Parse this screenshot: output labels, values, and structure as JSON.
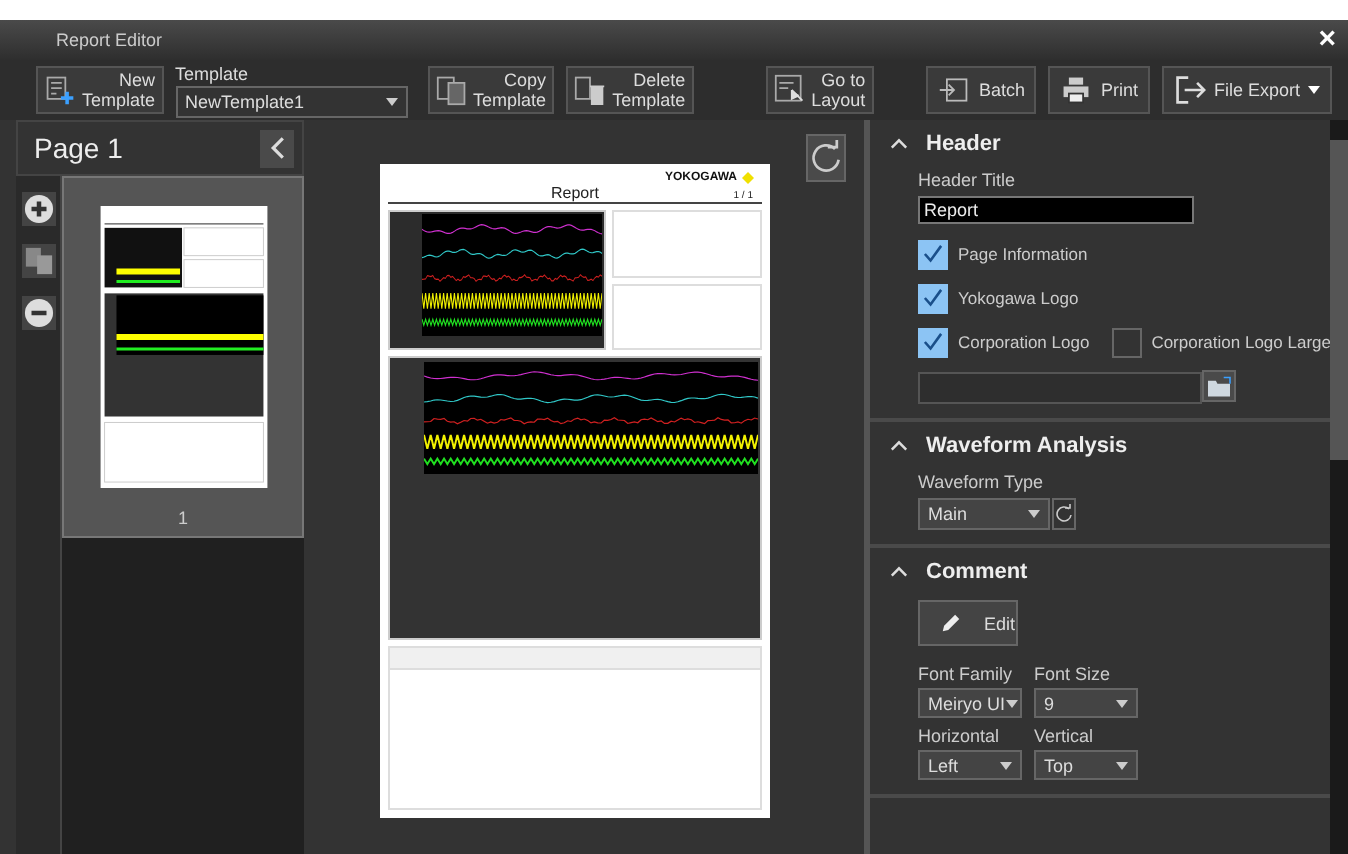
{
  "window": {
    "title": "Report Editor",
    "close": "×"
  },
  "toolbar": {
    "new_button": {
      "kind": "new",
      "label": [
        "New",
        "Template"
      ]
    },
    "template": {
      "label": "Template",
      "value": "NewTemplate1"
    },
    "buttons": [
      {
        "kind": "copy",
        "label": [
          "Copy",
          "Template"
        ]
      },
      {
        "kind": "delete",
        "label": [
          "Delete",
          "Template"
        ]
      },
      {
        "kind": "layout",
        "label": [
          "Go to",
          "Layout"
        ]
      }
    ],
    "right_buttons": [
      {
        "kind": "batch",
        "label": "Batch"
      },
      {
        "kind": "print",
        "label": "Print"
      },
      {
        "kind": "export",
        "label": "File Export"
      }
    ]
  },
  "pages": {
    "title": "Page 1",
    "thumbnails": [
      {
        "number": "1",
        "selected": true
      }
    ]
  },
  "preview": {
    "logo": "YOKOGAWA",
    "title": "Report",
    "page": "1 / 1"
  },
  "sections": [
    {
      "kind": "header",
      "title": "Header",
      "expanded": true,
      "title_label": "Header Title",
      "title_value": "Report",
      "checkboxes": [
        {
          "label": "Page Information",
          "checked": true
        },
        {
          "label": "Yokogawa Logo",
          "checked": true
        },
        {
          "label": "Corporation Logo",
          "checked": true
        },
        {
          "label": "Corporation Logo Large",
          "checked": false
        }
      ]
    },
    {
      "kind": "waveform",
      "title": "Waveform Analysis",
      "expanded": true,
      "type_label": "Waveform Type",
      "type_value": "Main"
    },
    {
      "kind": "comment",
      "title": "Comment",
      "expanded": true,
      "edit": "Edit",
      "fields": [
        {
          "label": "Font Family",
          "value": "Meiryo UI"
        },
        {
          "label": "Font Size",
          "value": "9"
        },
        {
          "label": "Horizontal",
          "value": "Left"
        },
        {
          "label": "Vertical",
          "value": "Top"
        }
      ]
    }
  ]
}
